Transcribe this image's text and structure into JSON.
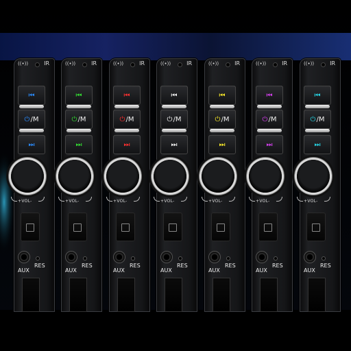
{
  "image": "Row of car stereo front faceplates with multi-color illuminated buttons",
  "panel_labels": {
    "ir": "IR",
    "ir_sensor_icon": "((•))",
    "prev_icon": "⏮",
    "mode_icon": "⏻",
    "mode_text": "/M",
    "next_icon": "⏭",
    "vol": "+VOL-",
    "aux": "AUX",
    "res": "RES"
  },
  "panels": [
    {
      "accent": "#2b8cff"
    },
    {
      "accent": "#33dd33"
    },
    {
      "accent": "#ff3030"
    },
    {
      "accent": "#f0f0f0"
    },
    {
      "accent": "#f5e62a"
    },
    {
      "accent": "#d640f0"
    },
    {
      "accent": "#27d6e6"
    }
  ]
}
